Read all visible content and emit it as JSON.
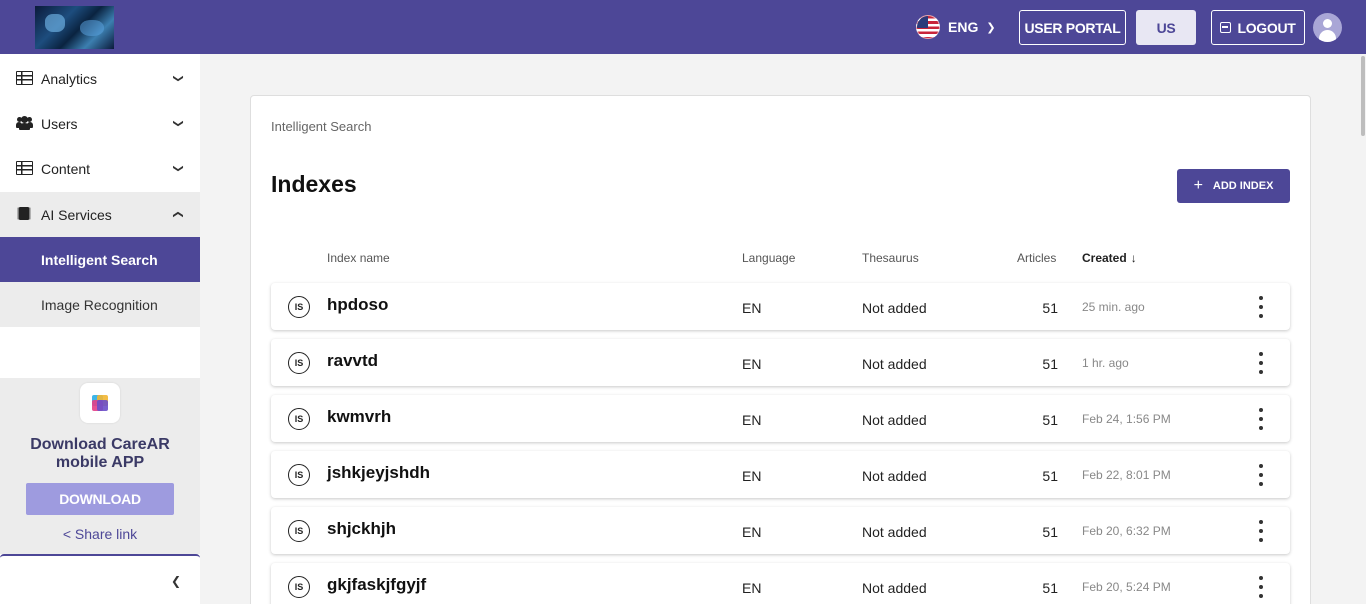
{
  "header": {
    "language": "ENG",
    "user_portal_label": "USER PORTAL",
    "region_label": "US",
    "logout_label": "LOGOUT"
  },
  "sidebar": {
    "items": [
      {
        "label": "Analytics",
        "icon": "table-icon"
      },
      {
        "label": "Users",
        "icon": "users-icon"
      },
      {
        "label": "Content",
        "icon": "table-icon"
      },
      {
        "label": "AI Services",
        "icon": "chip-icon"
      }
    ],
    "sub_items": [
      {
        "label": "Intelligent Search",
        "active": true
      },
      {
        "label": "Image Recognition",
        "active": false
      }
    ],
    "promo": {
      "title_line1": "Download CareAR",
      "title_line2": "mobile APP",
      "button": "DOWNLOAD",
      "share": "Share link"
    }
  },
  "main": {
    "breadcrumb": "Intelligent Search",
    "title": "Indexes",
    "add_button": "ADD INDEX",
    "columns": {
      "name": "Index name",
      "language": "Language",
      "thesaurus": "Thesaurus",
      "articles": "Articles",
      "created": "Created"
    },
    "rows": [
      {
        "badge": "IS",
        "name": "hpdoso",
        "language": "EN",
        "thesaurus": "Not added",
        "articles": "51",
        "created": "25 min. ago"
      },
      {
        "badge": "IS",
        "name": "ravvtd",
        "language": "EN",
        "thesaurus": "Not added",
        "articles": "51",
        "created": "1 hr. ago"
      },
      {
        "badge": "IS",
        "name": "kwmvrh",
        "language": "EN",
        "thesaurus": "Not added",
        "articles": "51",
        "created": "Feb 24, 1:56 PM"
      },
      {
        "badge": "IS",
        "name": "jshkjeyjshdh",
        "language": "EN",
        "thesaurus": "Not added",
        "articles": "51",
        "created": "Feb 22, 8:01 PM"
      },
      {
        "badge": "IS",
        "name": "shjckhjh",
        "language": "EN",
        "thesaurus": "Not added",
        "articles": "51",
        "created": "Feb 20, 6:32 PM"
      },
      {
        "badge": "IS",
        "name": "gkjfaskjfgyjf",
        "language": "EN",
        "thesaurus": "Not added",
        "articles": "51",
        "created": "Feb 20, 5:24 PM"
      }
    ]
  },
  "colors": {
    "brand": "#4d4797",
    "brand_light": "#9e9bdf",
    "background": "#f3f3f3"
  }
}
